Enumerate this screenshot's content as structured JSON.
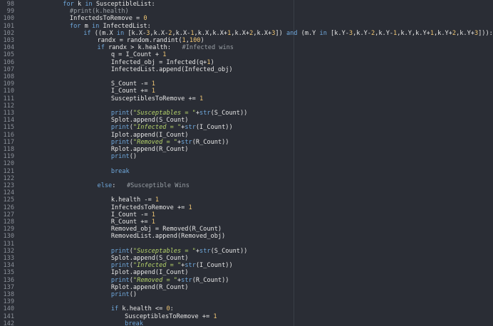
{
  "editor": {
    "colors": {
      "background": "#2a2d35",
      "line_number": "#8a8f98",
      "text": "#e6e6e6",
      "keyword": "#6fa8dc",
      "number": "#f0c674",
      "string": "#b5d36a",
      "comment": "#9aa0a6"
    },
    "lines": [
      {
        "n": "98",
        "indent": 5,
        "segs": [
          [
            "kw",
            "for "
          ],
          [
            "pl",
            "k "
          ],
          [
            "kw",
            "in "
          ],
          [
            "pl",
            "SusceptibleList:"
          ]
        ]
      },
      {
        "n": "99",
        "indent": 6,
        "segs": [
          [
            "cm",
            "#print(k.health)"
          ]
        ]
      },
      {
        "n": "100",
        "indent": 6,
        "segs": [
          [
            "pl",
            "InfectedsToRemove = "
          ],
          [
            "num",
            "0"
          ]
        ]
      },
      {
        "n": "101",
        "indent": 6,
        "segs": [
          [
            "kw",
            "for "
          ],
          [
            "pl",
            "m "
          ],
          [
            "kw",
            "in "
          ],
          [
            "pl",
            "InfectedList:"
          ]
        ]
      },
      {
        "n": "102",
        "indent": 8,
        "segs": [
          [
            "kw",
            "if "
          ],
          [
            "pl",
            "((m.X "
          ],
          [
            "kw",
            "in "
          ],
          [
            "pl",
            "[k.X-"
          ],
          [
            "num",
            "3"
          ],
          [
            "pl",
            ",k.X-"
          ],
          [
            "num",
            "2"
          ],
          [
            "pl",
            ",k.X-"
          ],
          [
            "num",
            "1"
          ],
          [
            "pl",
            ",k.X,k.X+"
          ],
          [
            "num",
            "1"
          ],
          [
            "pl",
            ",k.X+"
          ],
          [
            "num",
            "2"
          ],
          [
            "pl",
            ",k.X+"
          ],
          [
            "num",
            "3"
          ],
          [
            "pl",
            "]) "
          ],
          [
            "kw",
            "and "
          ],
          [
            "pl",
            "(m.Y "
          ],
          [
            "kw",
            "in "
          ],
          [
            "pl",
            "[k.Y-"
          ],
          [
            "num",
            "3"
          ],
          [
            "pl",
            ",k.Y-"
          ],
          [
            "num",
            "2"
          ],
          [
            "pl",
            ",k.Y-"
          ],
          [
            "num",
            "1"
          ],
          [
            "pl",
            ",k.Y,k.Y+"
          ],
          [
            "num",
            "1"
          ],
          [
            "pl",
            ",k.Y+"
          ],
          [
            "num",
            "2"
          ],
          [
            "pl",
            ",k.Y+"
          ],
          [
            "num",
            "3"
          ],
          [
            "pl",
            "])):"
          ]
        ]
      },
      {
        "n": "103",
        "indent": 10,
        "segs": [
          [
            "pl",
            "randx = random.randint("
          ],
          [
            "num",
            "1"
          ],
          [
            "pl",
            ","
          ],
          [
            "num",
            "100"
          ],
          [
            "pl",
            ")"
          ]
        ]
      },
      {
        "n": "104",
        "indent": 10,
        "segs": [
          [
            "kw",
            "if "
          ],
          [
            "pl",
            "randx > k.health:   "
          ],
          [
            "cm",
            "#Infected wins"
          ]
        ]
      },
      {
        "n": "105",
        "indent": 12,
        "segs": [
          [
            "pl",
            "q = I_Count + "
          ],
          [
            "num",
            "1"
          ]
        ]
      },
      {
        "n": "106",
        "indent": 12,
        "segs": [
          [
            "pl",
            "Infected_obj = Infected(q+"
          ],
          [
            "num",
            "1"
          ],
          [
            "pl",
            ")"
          ]
        ]
      },
      {
        "n": "107",
        "indent": 12,
        "segs": [
          [
            "pl",
            "InfectedList.append(Infected_obj)"
          ]
        ]
      },
      {
        "n": "108",
        "indent": 0,
        "segs": []
      },
      {
        "n": "109",
        "indent": 12,
        "segs": [
          [
            "pl",
            "S_Count -= "
          ],
          [
            "num",
            "1"
          ]
        ]
      },
      {
        "n": "110",
        "indent": 12,
        "segs": [
          [
            "pl",
            "I_Count += "
          ],
          [
            "num",
            "1"
          ]
        ]
      },
      {
        "n": "111",
        "indent": 12,
        "segs": [
          [
            "pl",
            "SusceptiblesToRemove += "
          ],
          [
            "num",
            "1"
          ]
        ]
      },
      {
        "n": "112",
        "indent": 0,
        "segs": []
      },
      {
        "n": "113",
        "indent": 12,
        "segs": [
          [
            "kw",
            "print"
          ],
          [
            "pl",
            "("
          ],
          [
            "str",
            "\"Susceptables = \""
          ],
          [
            "pl",
            "+"
          ],
          [
            "kw",
            "str"
          ],
          [
            "pl",
            "(S_Count))"
          ]
        ]
      },
      {
        "n": "114",
        "indent": 12,
        "segs": [
          [
            "pl",
            "Splot.append(S_Count)"
          ]
        ]
      },
      {
        "n": "115",
        "indent": 12,
        "segs": [
          [
            "kw",
            "print"
          ],
          [
            "pl",
            "("
          ],
          [
            "str",
            "\"Infected = \""
          ],
          [
            "pl",
            "+"
          ],
          [
            "kw",
            "str"
          ],
          [
            "pl",
            "(I_Count))"
          ]
        ]
      },
      {
        "n": "116",
        "indent": 12,
        "segs": [
          [
            "pl",
            "Iplot.append(I_Count)"
          ]
        ]
      },
      {
        "n": "117",
        "indent": 12,
        "segs": [
          [
            "kw",
            "print"
          ],
          [
            "pl",
            "("
          ],
          [
            "str",
            "\"Removed = \""
          ],
          [
            "pl",
            "+"
          ],
          [
            "kw",
            "str"
          ],
          [
            "pl",
            "(R_Count))"
          ]
        ]
      },
      {
        "n": "118",
        "indent": 12,
        "segs": [
          [
            "pl",
            "Rplot.append(R_Count)"
          ]
        ]
      },
      {
        "n": "119",
        "indent": 12,
        "segs": [
          [
            "kw",
            "print"
          ],
          [
            "pl",
            "()"
          ]
        ]
      },
      {
        "n": "120",
        "indent": 0,
        "segs": []
      },
      {
        "n": "121",
        "indent": 12,
        "segs": [
          [
            "kw",
            "break"
          ]
        ]
      },
      {
        "n": "122",
        "indent": 0,
        "segs": []
      },
      {
        "n": "123",
        "indent": 10,
        "segs": [
          [
            "kw",
            "else"
          ],
          [
            "pl",
            ":   "
          ],
          [
            "cm",
            "#Susceptible Wins"
          ]
        ]
      },
      {
        "n": "124",
        "indent": 0,
        "segs": []
      },
      {
        "n": "125",
        "indent": 12,
        "segs": [
          [
            "pl",
            "k.health -= "
          ],
          [
            "num",
            "1"
          ]
        ]
      },
      {
        "n": "126",
        "indent": 12,
        "segs": [
          [
            "pl",
            "InfectedsToRemove += "
          ],
          [
            "num",
            "1"
          ]
        ]
      },
      {
        "n": "127",
        "indent": 12,
        "segs": [
          [
            "pl",
            "I_Count -= "
          ],
          [
            "num",
            "1"
          ]
        ]
      },
      {
        "n": "128",
        "indent": 12,
        "segs": [
          [
            "pl",
            "R_Count += "
          ],
          [
            "num",
            "1"
          ]
        ]
      },
      {
        "n": "129",
        "indent": 12,
        "segs": [
          [
            "pl",
            "Removed_obj = Removed(R_Count)"
          ]
        ]
      },
      {
        "n": "130",
        "indent": 12,
        "segs": [
          [
            "pl",
            "RemovedList.append(Removed_obj)"
          ]
        ]
      },
      {
        "n": "131",
        "indent": 0,
        "segs": []
      },
      {
        "n": "132",
        "indent": 12,
        "segs": [
          [
            "kw",
            "print"
          ],
          [
            "pl",
            "("
          ],
          [
            "str",
            "\"Susceptables = \""
          ],
          [
            "pl",
            "+"
          ],
          [
            "kw",
            "str"
          ],
          [
            "pl",
            "(S_Count))"
          ]
        ]
      },
      {
        "n": "133",
        "indent": 12,
        "segs": [
          [
            "pl",
            "Splot.append(S_Count)"
          ]
        ]
      },
      {
        "n": "134",
        "indent": 12,
        "segs": [
          [
            "kw",
            "print"
          ],
          [
            "pl",
            "("
          ],
          [
            "str",
            "\"Infected = \""
          ],
          [
            "pl",
            "+"
          ],
          [
            "kw",
            "str"
          ],
          [
            "pl",
            "(I_Count))"
          ]
        ]
      },
      {
        "n": "135",
        "indent": 12,
        "segs": [
          [
            "pl",
            "Iplot.append(I_Count)"
          ]
        ]
      },
      {
        "n": "136",
        "indent": 12,
        "segs": [
          [
            "kw",
            "print"
          ],
          [
            "pl",
            "("
          ],
          [
            "str",
            "\"Removed = \""
          ],
          [
            "pl",
            "+"
          ],
          [
            "kw",
            "str"
          ],
          [
            "pl",
            "(R_Count))"
          ]
        ]
      },
      {
        "n": "137",
        "indent": 12,
        "segs": [
          [
            "pl",
            "Rplot.append(R_Count)"
          ]
        ]
      },
      {
        "n": "138",
        "indent": 12,
        "segs": [
          [
            "kw",
            "print"
          ],
          [
            "pl",
            "()"
          ]
        ]
      },
      {
        "n": "139",
        "indent": 0,
        "segs": []
      },
      {
        "n": "140",
        "indent": 12,
        "segs": [
          [
            "kw",
            "if "
          ],
          [
            "pl",
            "k.health <= "
          ],
          [
            "num",
            "0"
          ],
          [
            "pl",
            ":"
          ]
        ]
      },
      {
        "n": "141",
        "indent": 14,
        "segs": [
          [
            "pl",
            "SusceptiblesToRemove += "
          ],
          [
            "num",
            "1"
          ]
        ]
      },
      {
        "n": "142",
        "indent": 14,
        "segs": [
          [
            "kw",
            "break"
          ]
        ]
      }
    ]
  }
}
